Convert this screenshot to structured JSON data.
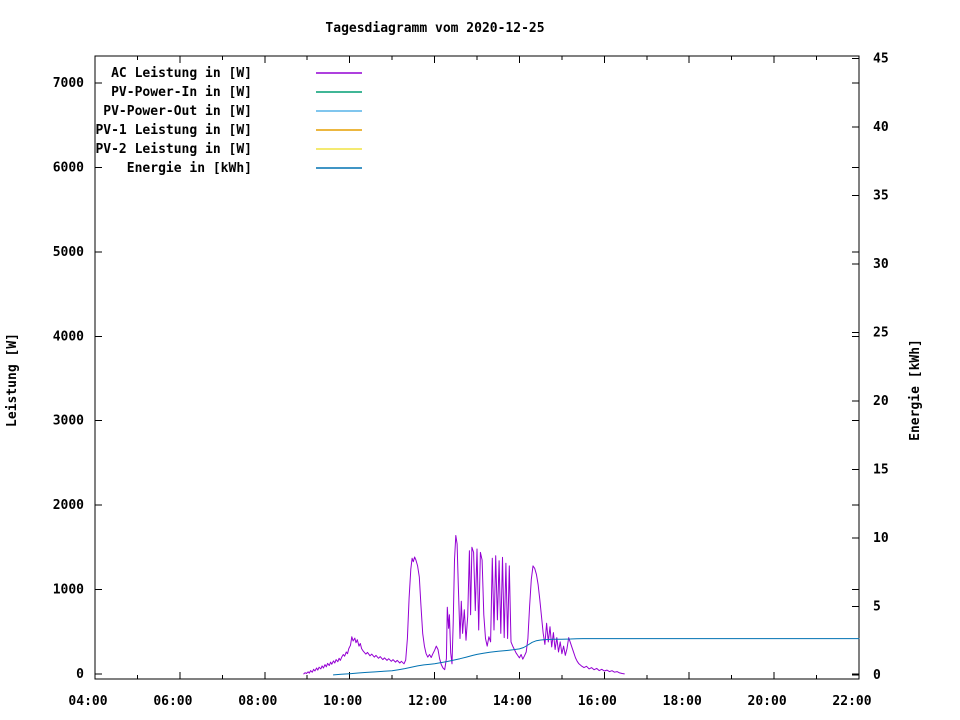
{
  "chart_data": {
    "type": "line",
    "title": "Tagesdiagramm vom 2020-12-25",
    "background_color": "#ffffff",
    "border_color": "#000000",
    "x_axis": {
      "range_hours": [
        4,
        22
      ],
      "labeled_tick_hours": [
        4,
        6,
        8,
        10,
        12,
        14,
        16,
        18,
        20,
        22
      ],
      "labeled_ticks": [
        "04:00",
        "06:00",
        "08:00",
        "10:00",
        "12:00",
        "14:00",
        "16:00",
        "18:00",
        "20:00",
        "22:00"
      ],
      "minor_tick_interval_hours": 1
    },
    "y1_axis": {
      "label": "Leistung [W]",
      "ticks": [
        0,
        1000,
        2000,
        3000,
        4000,
        5000,
        6000,
        7000
      ],
      "range": [
        -60,
        7320
      ]
    },
    "y2_axis": {
      "label": "Energie [kWh]",
      "ticks": [
        0,
        5,
        10,
        15,
        20,
        25,
        30,
        35,
        40,
        45
      ],
      "range": [
        -0.3,
        45.2
      ]
    },
    "legend": {
      "position": "top-left"
    },
    "series": [
      {
        "name": "AC Leistung in [W]",
        "color": "#9400D3",
        "axis": "y1",
        "points": [
          [
            8.92,
            0
          ],
          [
            8.95,
            15
          ],
          [
            8.98,
            5
          ],
          [
            9.02,
            25
          ],
          [
            9.05,
            10
          ],
          [
            9.08,
            40
          ],
          [
            9.12,
            20
          ],
          [
            9.15,
            55
          ],
          [
            9.18,
            35
          ],
          [
            9.22,
            70
          ],
          [
            9.25,
            45
          ],
          [
            9.28,
            80
          ],
          [
            9.32,
            60
          ],
          [
            9.35,
            95
          ],
          [
            9.38,
            70
          ],
          [
            9.42,
            110
          ],
          [
            9.45,
            85
          ],
          [
            9.48,
            125
          ],
          [
            9.52,
            100
          ],
          [
            9.55,
            140
          ],
          [
            9.58,
            115
          ],
          [
            9.62,
            155
          ],
          [
            9.65,
            130
          ],
          [
            9.68,
            170
          ],
          [
            9.72,
            145
          ],
          [
            9.75,
            185
          ],
          [
            9.78,
            160
          ],
          [
            9.82,
            205
          ],
          [
            9.85,
            230
          ],
          [
            9.88,
            210
          ],
          [
            9.92,
            260
          ],
          [
            9.95,
            240
          ],
          [
            9.98,
            300
          ],
          [
            10.02,
            340
          ],
          [
            10.05,
            440
          ],
          [
            10.08,
            390
          ],
          [
            10.12,
            425
          ],
          [
            10.15,
            370
          ],
          [
            10.18,
            405
          ],
          [
            10.22,
            330
          ],
          [
            10.25,
            360
          ],
          [
            10.28,
            300
          ],
          [
            10.32,
            270
          ],
          [
            10.38,
            235
          ],
          [
            10.42,
            255
          ],
          [
            10.48,
            215
          ],
          [
            10.52,
            235
          ],
          [
            10.58,
            200
          ],
          [
            10.62,
            220
          ],
          [
            10.68,
            185
          ],
          [
            10.72,
            205
          ],
          [
            10.78,
            170
          ],
          [
            10.82,
            190
          ],
          [
            10.88,
            160
          ],
          [
            10.92,
            180
          ],
          [
            10.98,
            150
          ],
          [
            11.02,
            170
          ],
          [
            11.08,
            140
          ],
          [
            11.12,
            160
          ],
          [
            11.18,
            130
          ],
          [
            11.22,
            150
          ],
          [
            11.28,
            120
          ],
          [
            11.32,
            165
          ],
          [
            11.36,
            420
          ],
          [
            11.4,
            900
          ],
          [
            11.44,
            1240
          ],
          [
            11.47,
            1370
          ],
          [
            11.5,
            1330
          ],
          [
            11.53,
            1385
          ],
          [
            11.56,
            1350
          ],
          [
            11.6,
            1280
          ],
          [
            11.64,
            1150
          ],
          [
            11.68,
            800
          ],
          [
            11.72,
            480
          ],
          [
            11.76,
            330
          ],
          [
            11.8,
            240
          ],
          [
            11.84,
            200
          ],
          [
            11.88,
            230
          ],
          [
            11.92,
            195
          ],
          [
            11.96,
            240
          ],
          [
            12.0,
            280
          ],
          [
            12.04,
            330
          ],
          [
            12.08,
            290
          ],
          [
            12.12,
            180
          ],
          [
            12.16,
            110
          ],
          [
            12.2,
            70
          ],
          [
            12.24,
            50
          ],
          [
            12.28,
            180
          ],
          [
            12.3,
            790
          ],
          [
            12.33,
            540
          ],
          [
            12.35,
            700
          ],
          [
            12.38,
            250
          ],
          [
            12.41,
            120
          ],
          [
            12.44,
            600
          ],
          [
            12.47,
            1350
          ],
          [
            12.5,
            1640
          ],
          [
            12.53,
            1540
          ],
          [
            12.56,
            1050
          ],
          [
            12.6,
            420
          ],
          [
            12.63,
            860
          ],
          [
            12.66,
            480
          ],
          [
            12.7,
            760
          ],
          [
            12.74,
            400
          ],
          [
            12.78,
            680
          ],
          [
            12.82,
            1460
          ],
          [
            12.85,
            700
          ],
          [
            12.88,
            1500
          ],
          [
            12.92,
            1440
          ],
          [
            12.96,
            750
          ],
          [
            13.0,
            1480
          ],
          [
            13.04,
            520
          ],
          [
            13.08,
            1440
          ],
          [
            13.12,
            1350
          ],
          [
            13.16,
            700
          ],
          [
            13.2,
            420
          ],
          [
            13.24,
            330
          ],
          [
            13.28,
            440
          ],
          [
            13.32,
            380
          ],
          [
            13.36,
            1370
          ],
          [
            13.4,
            520
          ],
          [
            13.44,
            1400
          ],
          [
            13.48,
            640
          ],
          [
            13.52,
            1340
          ],
          [
            13.56,
            480
          ],
          [
            13.6,
            1380
          ],
          [
            13.64,
            430
          ],
          [
            13.68,
            1310
          ],
          [
            13.72,
            420
          ],
          [
            13.76,
            1280
          ],
          [
            13.8,
            380
          ],
          [
            13.84,
            330
          ],
          [
            13.88,
            290
          ],
          [
            13.92,
            250
          ],
          [
            13.96,
            220
          ],
          [
            14.0,
            190
          ],
          [
            14.04,
            230
          ],
          [
            14.08,
            175
          ],
          [
            14.12,
            215
          ],
          [
            14.16,
            260
          ],
          [
            14.2,
            420
          ],
          [
            14.24,
            800
          ],
          [
            14.28,
            1120
          ],
          [
            14.32,
            1280
          ],
          [
            14.36,
            1250
          ],
          [
            14.4,
            1180
          ],
          [
            14.44,
            1060
          ],
          [
            14.48,
            880
          ],
          [
            14.52,
            680
          ],
          [
            14.56,
            480
          ],
          [
            14.6,
            350
          ],
          [
            14.64,
            600
          ],
          [
            14.68,
            380
          ],
          [
            14.72,
            560
          ],
          [
            14.76,
            320
          ],
          [
            14.8,
            490
          ],
          [
            14.84,
            290
          ],
          [
            14.88,
            430
          ],
          [
            14.92,
            260
          ],
          [
            14.96,
            380
          ],
          [
            15.0,
            240
          ],
          [
            15.04,
            330
          ],
          [
            15.08,
            220
          ],
          [
            15.12,
            300
          ],
          [
            15.16,
            430
          ],
          [
            15.2,
            370
          ],
          [
            15.24,
            310
          ],
          [
            15.28,
            250
          ],
          [
            15.32,
            190
          ],
          [
            15.36,
            150
          ],
          [
            15.4,
            120
          ],
          [
            15.46,
            95
          ],
          [
            15.52,
            75
          ],
          [
            15.58,
            90
          ],
          [
            15.64,
            60
          ],
          [
            15.7,
            75
          ],
          [
            15.76,
            50
          ],
          [
            15.82,
            65
          ],
          [
            15.88,
            40
          ],
          [
            15.94,
            55
          ],
          [
            16.0,
            35
          ],
          [
            16.06,
            45
          ],
          [
            16.12,
            28
          ],
          [
            16.18,
            38
          ],
          [
            16.24,
            20
          ],
          [
            16.3,
            28
          ],
          [
            16.36,
            12
          ],
          [
            16.42,
            5
          ],
          [
            16.47,
            0
          ]
        ]
      },
      {
        "name": "PV-Power-In in [W]",
        "color": "#009E73",
        "axis": "y1",
        "points": []
      },
      {
        "name": "PV-Power-Out in [W]",
        "color": "#56B4E9",
        "axis": "y1",
        "points": []
      },
      {
        "name": "PV-1 Leistung in [W]",
        "color": "#E69F00",
        "axis": "y1",
        "points": []
      },
      {
        "name": "PV-2 Leistung in [W]",
        "color": "#F0E442",
        "axis": "y1",
        "points": []
      },
      {
        "name": "Energie in [kWh]",
        "color": "#0072B2",
        "axis": "y2",
        "points": [
          [
            9.62,
            0
          ],
          [
            9.8,
            0.04
          ],
          [
            10.0,
            0.09
          ],
          [
            10.2,
            0.14
          ],
          [
            10.4,
            0.18
          ],
          [
            10.6,
            0.22
          ],
          [
            10.8,
            0.26
          ],
          [
            11.0,
            0.3
          ],
          [
            11.15,
            0.38
          ],
          [
            11.3,
            0.46
          ],
          [
            11.45,
            0.56
          ],
          [
            11.6,
            0.66
          ],
          [
            11.75,
            0.73
          ],
          [
            11.9,
            0.78
          ],
          [
            12.0,
            0.82
          ],
          [
            12.15,
            0.9
          ],
          [
            12.3,
            0.98
          ],
          [
            12.45,
            1.08
          ],
          [
            12.6,
            1.18
          ],
          [
            12.75,
            1.3
          ],
          [
            12.9,
            1.42
          ],
          [
            13.0,
            1.5
          ],
          [
            13.15,
            1.58
          ],
          [
            13.3,
            1.65
          ],
          [
            13.5,
            1.72
          ],
          [
            13.7,
            1.78
          ],
          [
            13.85,
            1.83
          ],
          [
            14.0,
            1.9
          ],
          [
            14.1,
            2.0
          ],
          [
            14.2,
            2.18
          ],
          [
            14.3,
            2.38
          ],
          [
            14.4,
            2.5
          ],
          [
            14.5,
            2.55
          ],
          [
            14.6,
            2.58
          ],
          [
            14.8,
            2.6
          ],
          [
            15.0,
            2.61
          ],
          [
            15.2,
            2.62
          ],
          [
            15.35,
            2.64
          ],
          [
            15.5,
            2.65
          ],
          [
            16.0,
            2.65
          ],
          [
            17.0,
            2.65
          ],
          [
            18.0,
            2.65
          ],
          [
            19.0,
            2.65
          ],
          [
            20.0,
            2.65
          ],
          [
            21.0,
            2.65
          ],
          [
            22.0,
            2.65
          ]
        ]
      }
    ]
  }
}
